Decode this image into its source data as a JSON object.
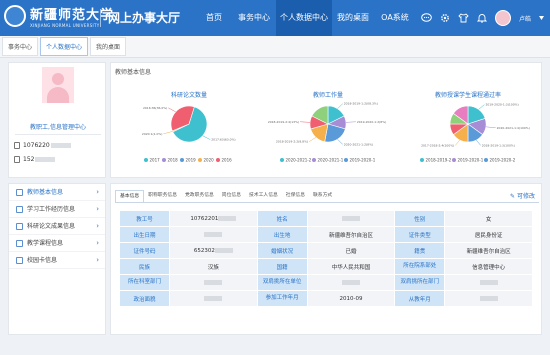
{
  "header": {
    "university_name": "新疆师范大学",
    "university_en": "XINJIANG NORMAL UNIVERSITY",
    "app_title": "网上办事大厅",
    "nav": [
      "首页",
      "事务中心",
      "个人数据中心",
      "我的桌面",
      "OA系统"
    ],
    "active_nav": 2,
    "user_name": "卢皓"
  },
  "tabs": [
    "事务中心",
    "个人数据中心",
    "我的桌面"
  ],
  "profile": {
    "dept": "教职工,信息管理中心",
    "id_number": "1076220",
    "phone": "152"
  },
  "side_menu": [
    "教师基本信息",
    "学习工作经历信息",
    "科研论文成果信息",
    "教学课程信息",
    "校园卡信息"
  ],
  "charts_section": {
    "title": "教师基本信息"
  },
  "chart_data": [
    {
      "type": "pie",
      "title": "科研论文数量",
      "categories": [
        "2017",
        "2018",
        "2019",
        "2020",
        "2016"
      ],
      "values": [
        63,
        0,
        0,
        1,
        36
      ],
      "colors": [
        "#3fc0cf",
        "#a78cd6",
        "#5b9ad8",
        "#f5b04c",
        "#ef5f6f"
      ],
      "slice_labels": [
        "2017:63(63.0%)",
        "2020:1(1.0%)",
        "2016:36(36.0%)"
      ]
    },
    {
      "type": "pie",
      "title": "教师工作量",
      "categories": [
        "2020-2021-2",
        "2020-2021-1",
        "2019-2020-1"
      ],
      "values": [
        3,
        2,
        4,
        3,
        2,
        3
      ],
      "colors": [
        "#3fc0cf",
        "#a78cd6",
        "#5b9ad8",
        "#f5b04c",
        "#ef5f6f",
        "#8ed07c"
      ],
      "slice_labels": [
        "2018-2019-1:2(08.3%)",
        "2019-2020-1:2(8%)",
        "2020-2021-1:2(8%)",
        "2018-2019-2:2(8.8%)",
        "2018-2019-2:4(13%)"
      ]
    },
    {
      "type": "pie",
      "title": "教师授课学生课程通过率",
      "categories": [
        "2018-2019-2",
        "2019-2020-1",
        "2019-2020-2"
      ],
      "values": [
        4,
        3,
        3,
        3,
        2,
        2,
        3
      ],
      "colors": [
        "#3fc0cf",
        "#a78cd6",
        "#5b9ad8",
        "#f5b04c",
        "#ef5f6f",
        "#8ed07c",
        "#e87dbf"
      ],
      "slice_labels": [
        "2019-2020-1:3(100%)",
        "2020-2021-1:4(100%)",
        "2018-2019-1:3(100%)",
        "2017-2018-2:4(100%)"
      ]
    }
  ],
  "detail": {
    "tabs": [
      "基本信息",
      "职称职务信息",
      "党政职务信息",
      "岗位信息",
      "技术工人信息",
      "社保信息",
      "联系方式"
    ],
    "edit_label": "可修改",
    "rows": [
      [
        {
          "k": "教工号",
          "v": "10762201"
        },
        {
          "k": "姓名",
          "v": ""
        },
        {
          "k": "性别",
          "v": "女"
        }
      ],
      [
        {
          "k": "出生日期",
          "v": ""
        },
        {
          "k": "出生地",
          "v": "新疆维吾尔自治区"
        },
        {
          "k": "证件类型",
          "v": "居民身份证"
        }
      ],
      [
        {
          "k": "证件号码",
          "v": "652302"
        },
        {
          "k": "婚姻状况",
          "v": "已婚"
        },
        {
          "k": "籍贯",
          "v": "新疆维吾尔自治区"
        }
      ],
      [
        {
          "k": "民族",
          "v": "汉族"
        },
        {
          "k": "国籍",
          "v": "中华人民共和国"
        },
        {
          "k": "所在院系部处",
          "v": "信息管理中心"
        }
      ],
      [
        {
          "k": "所在科室部门",
          "v": ""
        },
        {
          "k": "双肩挑所在单位",
          "v": ""
        },
        {
          "k": "双肩挑所在部门",
          "v": ""
        }
      ],
      [
        {
          "k": "政治面貌",
          "v": ""
        },
        {
          "k": "参加工作年月",
          "v": "2010-09"
        },
        {
          "k": "从教年月",
          "v": ""
        }
      ]
    ]
  }
}
